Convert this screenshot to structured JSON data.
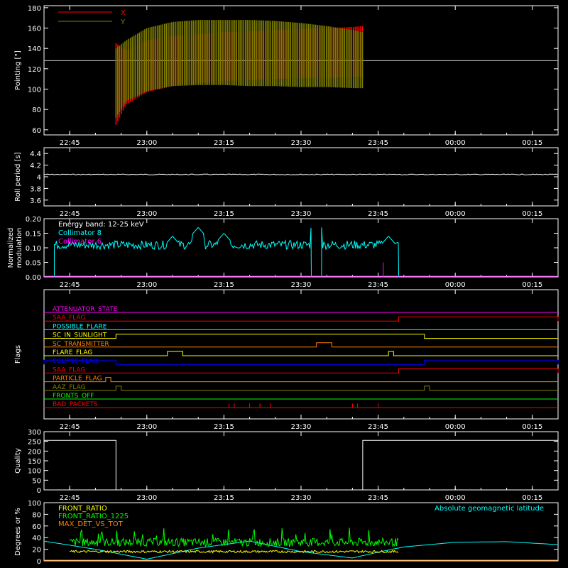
{
  "chart_data": [
    {
      "id": "pointing",
      "type": "line",
      "ylabel": "Pointing [\"]",
      "ylim": [
        55,
        182
      ],
      "yticks": [
        60,
        80,
        100,
        120,
        140,
        160,
        180
      ],
      "xticks": [
        "22:45",
        "23:00",
        "23:15",
        "23:30",
        "23:45",
        "00:00",
        "00:15"
      ],
      "reference_line": 128,
      "active_range": [
        "22:54",
        "23:42"
      ],
      "series": [
        {
          "name": "X",
          "color": "#ff0000",
          "x": [
            "22:54",
            "22:56",
            "23:00",
            "23:05",
            "23:10",
            "23:15",
            "23:20",
            "23:25",
            "23:30",
            "23:35",
            "23:40",
            "23:42"
          ],
          "low": [
            65,
            85,
            97,
            103,
            106,
            108,
            109,
            110,
            111,
            111,
            112,
            112
          ],
          "high": [
            145,
            138,
            148,
            152,
            154,
            156,
            157,
            158,
            159,
            160,
            161,
            162
          ]
        },
        {
          "name": "Y",
          "color": "#808000",
          "x": [
            "22:54",
            "22:56",
            "23:00",
            "23:05",
            "23:10",
            "23:15",
            "23:20",
            "23:25",
            "23:30",
            "23:35",
            "23:40",
            "23:42"
          ],
          "low": [
            72,
            88,
            98,
            103,
            104,
            104,
            103,
            103,
            102,
            102,
            101,
            101
          ],
          "high": [
            140,
            148,
            160,
            166,
            168,
            168,
            168,
            167,
            165,
            162,
            158,
            156
          ]
        }
      ]
    },
    {
      "id": "roll",
      "type": "line",
      "ylabel": "Roll period [s]",
      "ylim": [
        3.5,
        4.5
      ],
      "yticks": [
        3.6,
        3.8,
        4.0,
        4.2,
        4.4
      ],
      "xticks": [
        "22:45",
        "23:00",
        "23:15",
        "23:30",
        "23:45",
        "00:00",
        "00:15"
      ],
      "series": [
        {
          "name": "",
          "color": "#ffffff",
          "value": 4.04
        }
      ]
    },
    {
      "id": "modulation",
      "type": "line",
      "ylabel": "Normalized modulation",
      "ylim": [
        0,
        0.2
      ],
      "yticks": [
        "0.00",
        "0.05",
        "0.10",
        "0.15",
        "0.20"
      ],
      "xticks": [
        "22:45",
        "23:00",
        "23:15",
        "23:30",
        "23:45",
        "00:00",
        "00:15"
      ],
      "legend_title": "Energy band: 12-25 keV",
      "series": [
        {
          "name": "Collimator 8",
          "color": "#00ffff",
          "segments": [
            [
              "22:42",
              "23:32"
            ],
            [
              "23:34",
              "23:49"
            ]
          ],
          "baseline": 0.11,
          "peaks": [
            {
              "x": "23:05",
              "y": 0.14
            },
            {
              "x": "23:10",
              "y": 0.17
            },
            {
              "x": "23:15",
              "y": 0.15
            },
            {
              "x": "23:33",
              "y": 0.19
            },
            {
              "x": "23:47",
              "y": 0.14
            }
          ]
        },
        {
          "name": "Collimator 6",
          "color": "#ff00ff",
          "value": 0.0,
          "dips": [
            "23:46"
          ]
        }
      ]
    },
    {
      "id": "flags",
      "type": "line",
      "ylabel": "Flags",
      "xticks": [
        "22:45",
        "23:00",
        "23:15",
        "23:30",
        "23:45",
        "00:00",
        "00:15"
      ],
      "series": [
        {
          "name": "ATTENUATOR_STATE",
          "color": "#ff00ff",
          "on": []
        },
        {
          "name": "SAA_FLAG",
          "color": "#ff0000",
          "on": [
            [
              "23:49",
              "00:20"
            ]
          ]
        },
        {
          "name": "POSSIBLE_FLARE",
          "color": "#00ffff",
          "on": []
        },
        {
          "name": "SC_IN_SUNLIGHT",
          "color": "#ffff00",
          "on": [
            [
              "22:54",
              "23:54"
            ]
          ]
        },
        {
          "name": "SC_TRANSMITTER",
          "color": "#ff8000",
          "on": [
            [
              "23:33",
              "23:36"
            ]
          ]
        },
        {
          "name": "FLARE_FLAG",
          "color": "#ffff00",
          "on": [
            [
              "23:04",
              "23:07"
            ],
            [
              "23:47",
              "23:48"
            ]
          ]
        },
        {
          "name": "ECLIPSE_FLAG",
          "color": "#0000ff",
          "on": [
            [
              "22:40",
              "22:54"
            ],
            [
              "23:54",
              "00:20"
            ]
          ]
        },
        {
          "name": "SAA_FLAG",
          "color": "#ff0000",
          "on": [
            [
              "23:49",
              "00:20"
            ]
          ]
        },
        {
          "name": "PARTICLE_FLAG",
          "color": "#ff8000",
          "on": [
            [
              "22:52",
              "22:53"
            ]
          ]
        },
        {
          "name": "AAZ_FLAG",
          "color": "#808000",
          "on": [
            [
              "22:54",
              "22:55"
            ],
            [
              "23:54",
              "23:55"
            ]
          ]
        },
        {
          "name": "FRONTS_OFF",
          "color": "#00ff00",
          "on": []
        },
        {
          "name": "BAD_PACKETS",
          "color": "#ff0000",
          "ticks": [
            "23:16",
            "23:17",
            "23:20",
            "23:22",
            "23:24",
            "23:40",
            "23:41",
            "23:45"
          ]
        }
      ]
    },
    {
      "id": "quality",
      "type": "line",
      "ylabel": "Quality",
      "ylim": [
        0,
        300
      ],
      "yticks": [
        0,
        50,
        100,
        150,
        200,
        250,
        300
      ],
      "xticks": [
        "22:45",
        "23:00",
        "23:15",
        "23:30",
        "23:45",
        "00:00",
        "00:15"
      ],
      "series": [
        {
          "name": "",
          "color": "#ffffff",
          "steps": [
            [
              "22:40",
              255
            ],
            [
              "22:54",
              0
            ],
            [
              "23:42",
              255
            ],
            [
              "00:20",
              255
            ]
          ]
        }
      ]
    },
    {
      "id": "ratios",
      "type": "line",
      "ylabel": "Degrees or %",
      "ylim": [
        0,
        100
      ],
      "yticks": [
        0,
        20,
        40,
        60,
        80,
        100
      ],
      "legend_right": "Absolute geomagnetic latitude",
      "series": [
        {
          "name": "FRONT_RATIO",
          "color": "#ffff00",
          "level": 16,
          "range": [
            "22:45",
            "23:49"
          ]
        },
        {
          "name": "FRONT_RATIO_1225",
          "color": "#00ff00",
          "level": 32,
          "range": [
            "22:45",
            "23:49"
          ]
        },
        {
          "name": "MAX_DET_VS_TOT",
          "color": "#ff8000",
          "level": 0
        },
        {
          "name": "Absolute geomagnetic latitude",
          "color": "#00ffff",
          "x": [
            "22:40",
            "22:50",
            "23:00",
            "23:10",
            "23:20",
            "23:30",
            "23:40",
            "23:45",
            "23:50",
            "24:00",
            "24:10",
            "24:20"
          ],
          "y": [
            34,
            20,
            3,
            22,
            34,
            16,
            5,
            15,
            24,
            32,
            33,
            28
          ]
        }
      ]
    }
  ],
  "colors": {
    "background": "#000000",
    "axis": "#ffffff"
  }
}
